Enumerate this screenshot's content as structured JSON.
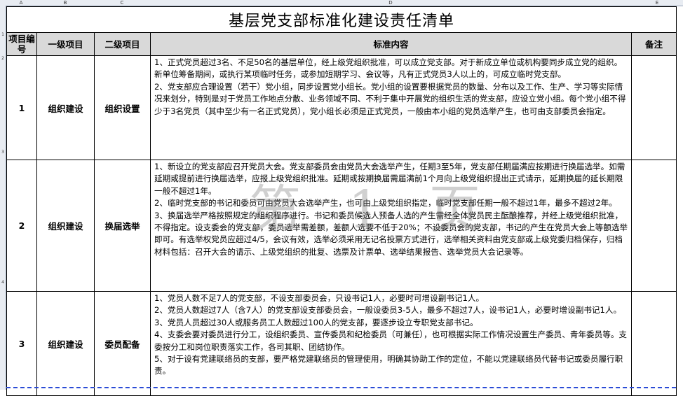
{
  "columns": [
    "A",
    "B",
    "C",
    "D",
    "E"
  ],
  "rows": [
    "1",
    "2",
    "3",
    "4"
  ],
  "title": "基层党支部标准化建设责任清单",
  "headers": {
    "num": "项目编号",
    "level1": "一级项目",
    "level2": "二级项目",
    "content": "标准内容",
    "note": "备注"
  },
  "items": [
    {
      "num": "1",
      "level1": "组织建设",
      "level2": "组织设置",
      "paragraphs": [
        "1、正式党员超过3名、不足50名的基层单位，经上级党组织批准，可以成立党支部。对于新成立单位或机构要同步成立党的组织。新单位筹备期间，或执行某项临时任务，或参加短期学习、会议等，凡有正式党员3人以上的，可成立临时党支部。",
        "2、党支部应合理设置（若干）党小组，同步设置党小组长。党小组的设置要根据党员的数量、分布以及工作、生产、学习等实际情况来划分，特别是对于党员工作地点分散、业务领域不同、不利于集中开展党的组织生活的党支部，应设立党小组。每个党小组不得少于3名党员（其中至少有一名正式党员），党小组长必须是正式党员，一般由本小组的党员选举产生，也可由支部委员会指定。"
      ],
      "note": ""
    },
    {
      "num": "2",
      "level1": "组织建设",
      "level2": "换届选举",
      "paragraphs": [
        "1、新设立的党支部应召开党员大会。党支部委员会由党员大会选举产生，任期3至5年，党支部任期届满应按期进行换届选举。如需延期或提前进行换届选举，应报上级党组织批准。延期或按期换届需届满前1个月向上级党组织提出正式请示，延期换届的延长期限一般不超过1年。",
        "2、临时党支部的书记和委员可由党员大会选举产生，也可由上级党组织指定，临时党支部任期一般不超过1年，最多不超过2年。",
        "3、换届选举严格按照规定的组织程序进行。书记和委员候选人预备人选的产生需经全体党员民主酝酿推荐，并经上级党组织批准，不得指定。设支委会的党支部，委员选举需差额，差额人选要不低于20%；不设委员会的党支部，书记的产生在党员大会上等额选举即可。有选举权党员应超过4/5，会议有效，选举必须采用无记名投票方式进行，选举相关资料由党支部或上级党委归档保存，归档材料包括：召开大会的请示、上级党组织的批复、选票及计票单、选举结果报告、选举党员大会记录等。"
      ],
      "note": ""
    },
    {
      "num": "3",
      "level1": "组织建设",
      "level2": "委员配备",
      "paragraphs": [
        "1、党员人数不足7人的党支部，不设支部委员会，只设书记1人，必要时可增设副书记1人。",
        "2、党员人数超过7人（含7人）的党支部设支部委员会，一般设委员3-5人，最多不超过7人，设书记1人，必要时增设副书记1人。",
        "3、党员人员超过30人或服务员工人数超过100人的党支部，要逐步设立专职党支部书记。",
        "4、支委会要对委员进行分工，设组织委员、宣传委员和纪检委员（可兼任），也可根据实际工作情况设置生产委员、青年委员等。支委按分工和岗位职责落实工作，各司其职、团结协作。",
        "5、对于设有党建联络员的支部，要严格党建联络员的管理使用，明确其协助工作的定位，不能以党建联络员代替书记或委员履行职责。"
      ],
      "note": ""
    }
  ],
  "watermark": "第 1 页"
}
